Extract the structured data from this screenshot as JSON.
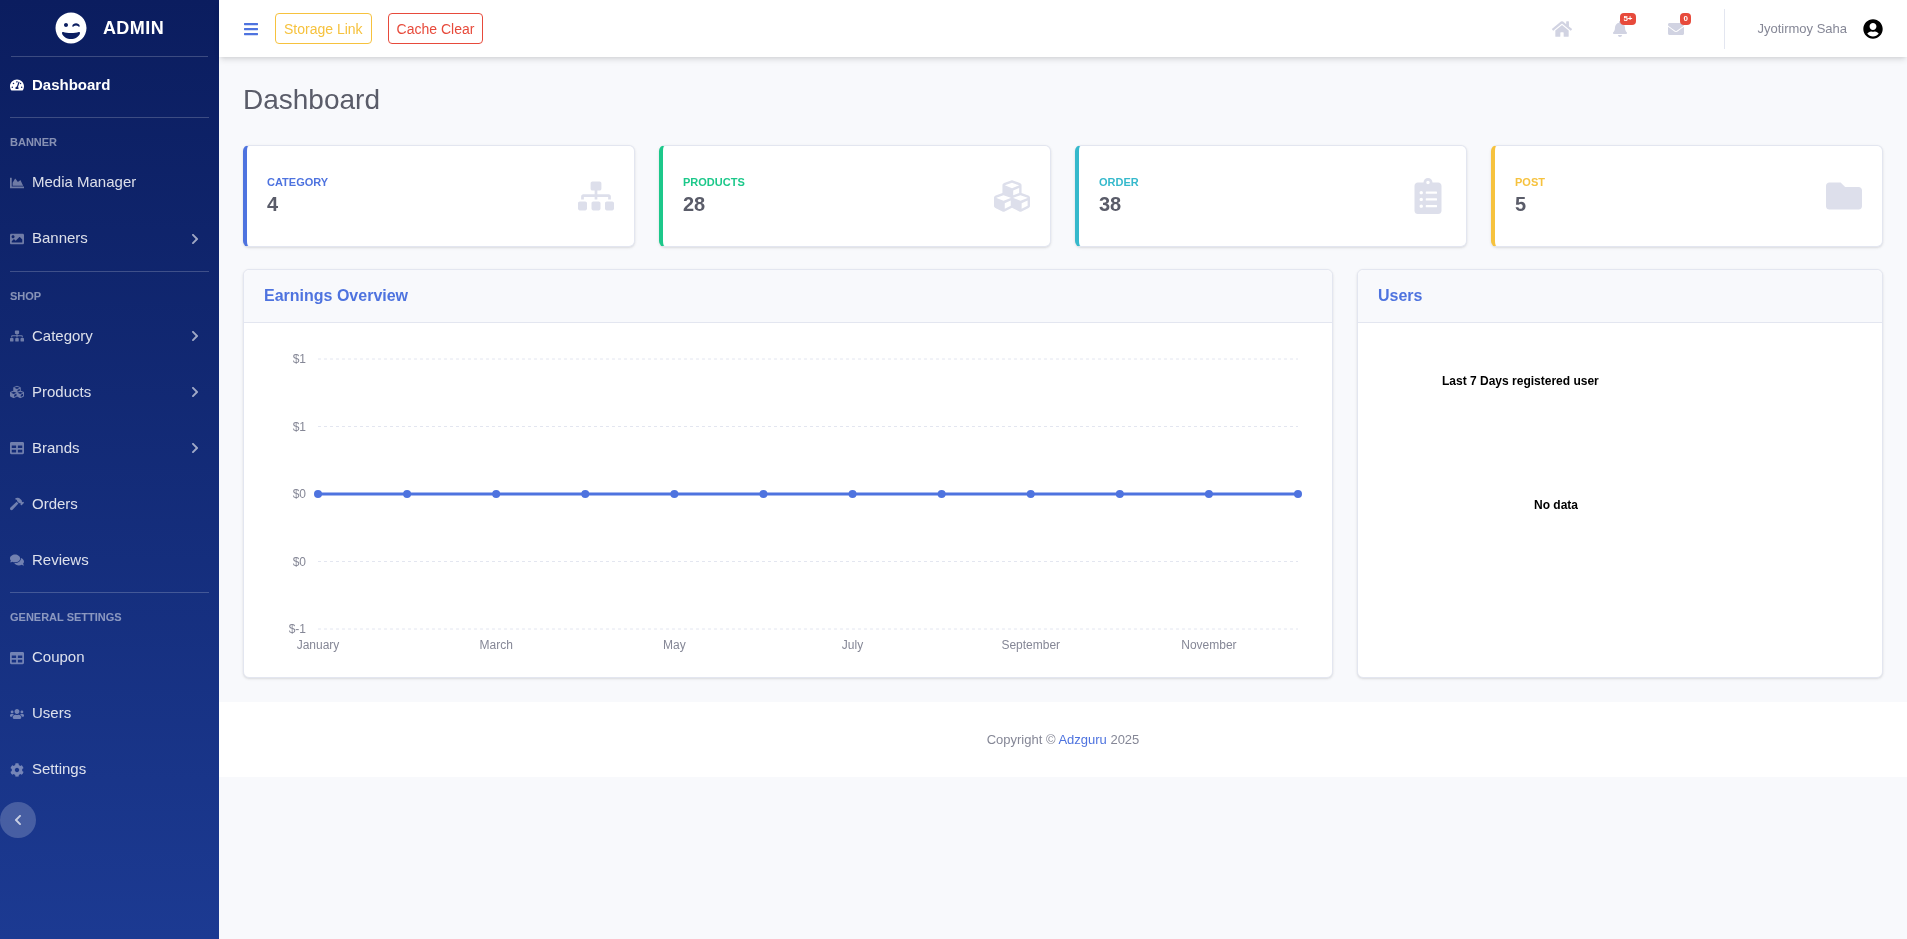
{
  "brand": {
    "name": "ADMIN"
  },
  "sidebar": {
    "groups": [
      {
        "items": [
          {
            "label": "Dashboard",
            "selected": true,
            "has_submenu": false
          }
        ]
      },
      {
        "heading": "BANNER",
        "items": [
          {
            "label": "Media Manager",
            "selected": false,
            "has_submenu": false
          },
          {
            "label": "Banners",
            "selected": false,
            "has_submenu": true
          }
        ]
      },
      {
        "heading": "SHOP",
        "items": [
          {
            "label": "Category",
            "selected": false,
            "has_submenu": true
          },
          {
            "label": "Products",
            "selected": false,
            "has_submenu": true
          },
          {
            "label": "Brands",
            "selected": false,
            "has_submenu": true
          },
          {
            "label": "Orders",
            "selected": false,
            "has_submenu": false
          },
          {
            "label": "Reviews",
            "selected": false,
            "has_submenu": false
          }
        ]
      },
      {
        "heading": "GENERAL SETTINGS",
        "items": [
          {
            "label": "Coupon",
            "selected": false,
            "has_submenu": false
          },
          {
            "label": "Users",
            "selected": false,
            "has_submenu": false
          },
          {
            "label": "Settings",
            "selected": false,
            "has_submenu": false
          }
        ]
      }
    ]
  },
  "topbar": {
    "buttons": [
      {
        "label": "Storage Link",
        "color": "#f6c23e"
      },
      {
        "label": "Cache Clear",
        "color": "#e74a3b"
      }
    ],
    "alerts_badge": "5+",
    "messages_badge": "0",
    "user_name": "Jyotirmoy Saha"
  },
  "page_title": "Dashboard",
  "stat_cards": [
    {
      "label": "CATEGORY",
      "value": "4",
      "color": "#4e73df"
    },
    {
      "label": "PRODUCTS",
      "value": "28",
      "color": "#1cc88a"
    },
    {
      "label": "ORDER",
      "value": "38",
      "color": "#36b9cc"
    },
    {
      "label": "POST",
      "value": "5",
      "color": "#f6c23e"
    }
  ],
  "earnings": {
    "title": "Earnings Overview",
    "chart_data": {
      "type": "line",
      "categories": [
        "January",
        null,
        "March",
        null,
        "May",
        null,
        "July",
        null,
        "September",
        null,
        "November",
        null
      ],
      "yticks": [
        {
          "value": 1,
          "label": "$1"
        },
        {
          "value": 0.5,
          "label": "$1"
        },
        {
          "value": 0,
          "label": "$0"
        },
        {
          "value": -0.5,
          "label": "$0"
        },
        {
          "value": -1,
          "label": "$-1"
        }
      ],
      "ylim": [
        -1,
        1
      ],
      "series": [
        {
          "color": "#4e73df",
          "marker": true,
          "values": [
            0,
            0,
            0,
            0,
            0,
            0,
            0,
            0,
            0,
            0,
            0,
            0
          ]
        }
      ]
    }
  },
  "users": {
    "title": "Users",
    "chart_title": "Last 7 Days registered user",
    "empty_text": "No data"
  },
  "footer": {
    "text": "Copyright © ",
    "link": "Adzguru",
    "year": " 2025"
  }
}
